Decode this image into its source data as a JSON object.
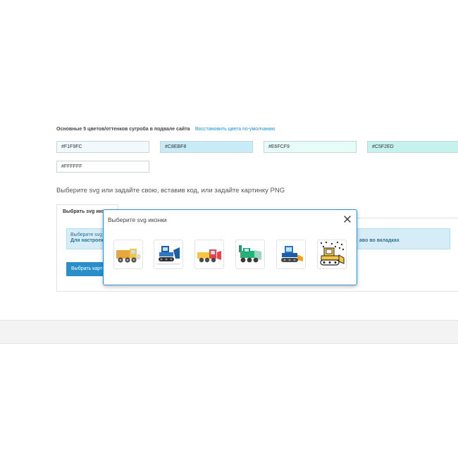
{
  "colors_section": {
    "title": "Основные 5 цветов/оттенков сугроба в подвале сайта",
    "restore_link": "Восстановить цвета по-умолчанию",
    "colors": [
      {
        "value": "#F1F9FC",
        "hex": "#F1F9FC"
      },
      {
        "value": "#C8EBF8",
        "hex": "#C8EBF8"
      },
      {
        "value": "#E6FCF9",
        "hex": "#E6FCF9"
      },
      {
        "value": "#C5F2ED",
        "hex": "#C5F2ED"
      },
      {
        "value": "#FFFFFF",
        "hex": "#FFFFFF"
      }
    ]
  },
  "svg_section": {
    "heading": "Выберите svg или задайте свою, вставив код, или задайте картинку PNG",
    "tabs": [
      {
        "label": "Выбрать svg иконки",
        "active": true
      }
    ],
    "info_line1": "Выберите svg",
    "info_line2": "Для настроек",
    "info_right": "аво во вкладках",
    "choose_button": "Выбрать картинку"
  },
  "modal": {
    "title": "Выберите svg иконки",
    "icons": [
      {
        "name": "dump-truck-icon"
      },
      {
        "name": "blue-bulldozer-icon"
      },
      {
        "name": "red-snowplow-truck-icon"
      },
      {
        "name": "green-snow-blower-icon"
      },
      {
        "name": "blue-snow-tractor-icon"
      },
      {
        "name": "yellow-snow-groomer-icon"
      }
    ]
  },
  "theme": {
    "accent": "#2A8FC9",
    "modal_border": "#3B8FD1",
    "info_bg": "#D6ECF6"
  }
}
